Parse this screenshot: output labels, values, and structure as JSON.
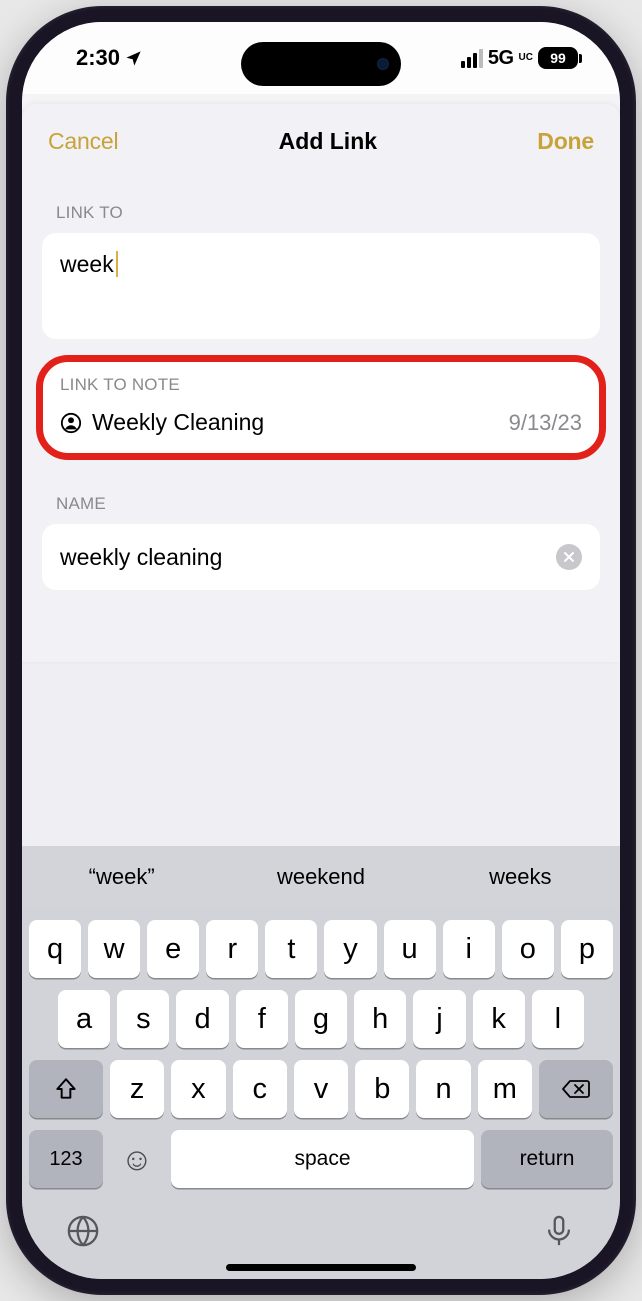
{
  "status": {
    "time": "2:30",
    "network": "5G",
    "uc": "UC",
    "battery": "99"
  },
  "nav": {
    "cancel": "Cancel",
    "title": "Add Link",
    "done": "Done"
  },
  "labels": {
    "link_to": "LINK TO",
    "link_to_note": "LINK TO NOTE",
    "name": "NAME"
  },
  "link_to_value": "week",
  "note_suggestion": {
    "title": "Weekly Cleaning",
    "date": "9/13/23"
  },
  "name_value": "weekly cleaning",
  "keyboard": {
    "suggestions": [
      "“week”",
      "weekend",
      "weeks"
    ],
    "row1": [
      "q",
      "w",
      "e",
      "r",
      "t",
      "y",
      "u",
      "i",
      "o",
      "p"
    ],
    "row2": [
      "a",
      "s",
      "d",
      "f",
      "g",
      "h",
      "j",
      "k",
      "l"
    ],
    "row3": [
      "z",
      "x",
      "c",
      "v",
      "b",
      "n",
      "m"
    ],
    "numkey": "123",
    "space": "space",
    "return": "return"
  }
}
